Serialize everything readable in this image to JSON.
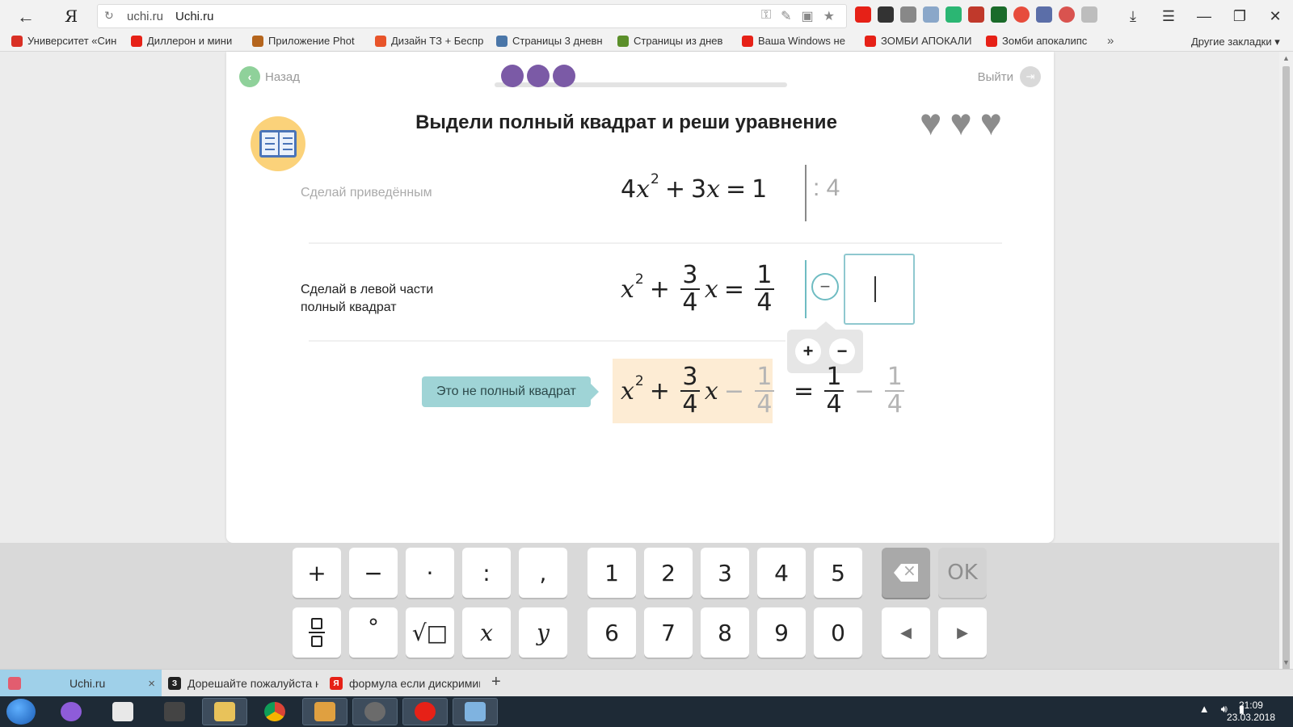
{
  "browser": {
    "url_domain": "uchi.ru",
    "tab_title": "Uchi.ru",
    "ya_logo": "Я",
    "bookmarks": [
      {
        "label": "Университет «Син",
        "color": "#d93025"
      },
      {
        "label": "Диллерон и мини",
        "color": "#e62117"
      },
      {
        "label": "Приложение Phot",
        "color": "#b5651d"
      },
      {
        "label": "Дизайн ТЗ + Беспр",
        "color": "#e8542a"
      },
      {
        "label": "Страницы 3 дневн",
        "color": "#4a76a8"
      },
      {
        "label": "Страницы из днев",
        "color": "#5b8f2a"
      },
      {
        "label": "Ваша Windows не",
        "color": "#e62117"
      },
      {
        "label": "ЗОМБИ АПОКАЛИ",
        "color": "#e62117"
      },
      {
        "label": "Зомби апокалипс",
        "color": "#e62117"
      }
    ],
    "bookmarks_more": "»",
    "other_bookmarks": "Другие закладки",
    "other_bookmarks_arrow": "▾",
    "bottom_tabs": [
      {
        "label": "Uchi.ru",
        "active": true,
        "icon_color": "#e25d6f",
        "icon_text": ""
      },
      {
        "label": "Дорешайте пожалуйста на",
        "active": false,
        "icon_color": "#222222",
        "icon_text": "З"
      },
      {
        "label": "формула если дискримина",
        "active": false,
        "icon_color": "#e62117",
        "icon_text": "Я"
      }
    ],
    "tab_close": "×",
    "new_tab": "+"
  },
  "lesson": {
    "back_label": "Назад",
    "exit_label": "Выйти",
    "progress_dots": 3,
    "title": "Выдели полный квадрат и реши уравнение",
    "lives": 3,
    "step1": {
      "label": "Сделай приведённым",
      "eq": {
        "coef": "4",
        "var": "x",
        "exp": "2",
        "plus": "+",
        "coef2": "3",
        "var2": "x",
        "eq": "=",
        "rhs": "1"
      },
      "action": ": 4"
    },
    "step2": {
      "label_line1": "Сделай в левой части",
      "label_line2": "полный квадрат",
      "eq": {
        "var": "x",
        "exp": "2",
        "plus": "+",
        "num": "3",
        "den": "4",
        "var2": "x",
        "eq": "=",
        "rhs_num": "1",
        "rhs_den": "4"
      },
      "action_sign": "−",
      "popover_plus": "+",
      "popover_minus": "−"
    },
    "step3": {
      "hint": "Это не полный квадрат",
      "eq": {
        "var": "x",
        "exp": "2",
        "plus": "+",
        "num": "3",
        "den": "4",
        "var2": "x",
        "minus": "−",
        "sub_num": "1",
        "sub_den": "4",
        "eq": "=",
        "rhs_num": "1",
        "rhs_den": "4",
        "minus2": "−",
        "sub2_num": "1",
        "sub2_den": "4"
      }
    }
  },
  "keyboard": {
    "row1": [
      "+",
      "−",
      "·",
      ":",
      ",",
      "1",
      "2",
      "3",
      "4",
      "5"
    ],
    "row2_symbols": [
      "°",
      "√□",
      "x",
      "y"
    ],
    "row2_digits": [
      "6",
      "7",
      "8",
      "9",
      "0"
    ],
    "ok": "OK",
    "left": "◀",
    "right": "▶"
  },
  "system": {
    "time": "21:09",
    "date": "23.03.2018"
  }
}
